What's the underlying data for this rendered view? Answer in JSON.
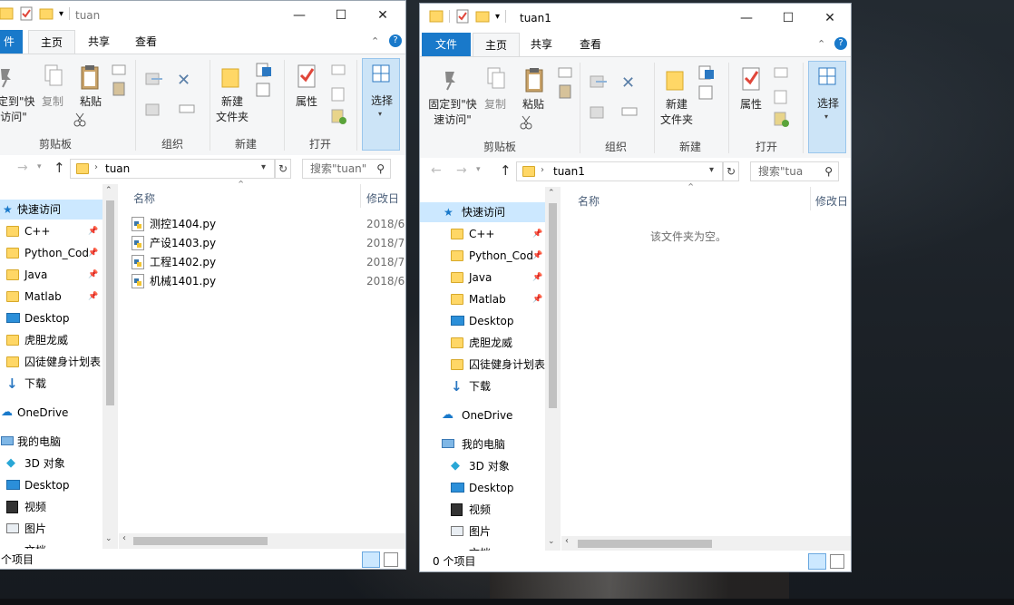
{
  "left_window": {
    "title": "tuan",
    "tabs": {
      "file": "件",
      "home": "主页",
      "share": "共享",
      "view": "查看"
    },
    "ribbon": {
      "pin": "定到\"快\n访问\"",
      "copy": "复制",
      "paste": "粘贴",
      "new_folder": "新建\n文件夹",
      "properties": "属性",
      "select": "选择",
      "groups": {
        "clipboard": "剪贴板",
        "organize": "组织",
        "new": "新建",
        "open": "打开"
      }
    },
    "address": {
      "path": "tuan",
      "search_placeholder": "搜索\"tuan\""
    },
    "nav": {
      "quick_access": "快速访问",
      "items": [
        "C++",
        "Python_Cod",
        "Java",
        "Matlab",
        "Desktop",
        "虎胆龙威",
        "囚徒健身计划表",
        "下载"
      ],
      "onedrive": "OneDrive",
      "this_pc": "我的电脑",
      "pc_items": [
        "3D 对象",
        "Desktop",
        "视频",
        "图片",
        "文档"
      ]
    },
    "columns": {
      "name": "名称",
      "modified": "修改日"
    },
    "files": [
      {
        "name": "测控1404.py",
        "date": "2018/6"
      },
      {
        "name": "产设1403.py",
        "date": "2018/7"
      },
      {
        "name": "工程1402.py",
        "date": "2018/7"
      },
      {
        "name": "机械1401.py",
        "date": "2018/6"
      }
    ],
    "status": "个项目"
  },
  "right_window": {
    "title": "tuan1",
    "tabs": {
      "file": "文件",
      "home": "主页",
      "share": "共享",
      "view": "查看"
    },
    "ribbon": {
      "pin": "固定到\"快\n速访问\"",
      "copy": "复制",
      "paste": "粘贴",
      "new_folder": "新建\n文件夹",
      "properties": "属性",
      "select": "选择",
      "groups": {
        "clipboard": "剪贴板",
        "organize": "组织",
        "new": "新建",
        "open": "打开"
      }
    },
    "address": {
      "path": "tuan1",
      "search_placeholder": "搜索\"tua"
    },
    "nav": {
      "quick_access": "快速访问",
      "items": [
        "C++",
        "Python_Cod",
        "Java",
        "Matlab",
        "Desktop",
        "虎胆龙威",
        "囚徒健身计划表",
        "下载"
      ],
      "onedrive": "OneDrive",
      "this_pc": "我的电脑",
      "pc_items": [
        "3D 对象",
        "Desktop",
        "视频",
        "图片",
        "文档"
      ]
    },
    "columns": {
      "name": "名称",
      "modified": "修改日"
    },
    "empty_message": "该文件夹为空。",
    "status": "0 个项目"
  },
  "colors": {
    "accent": "#1979ca",
    "selection": "#cce8ff",
    "folder": "#ffd766"
  }
}
